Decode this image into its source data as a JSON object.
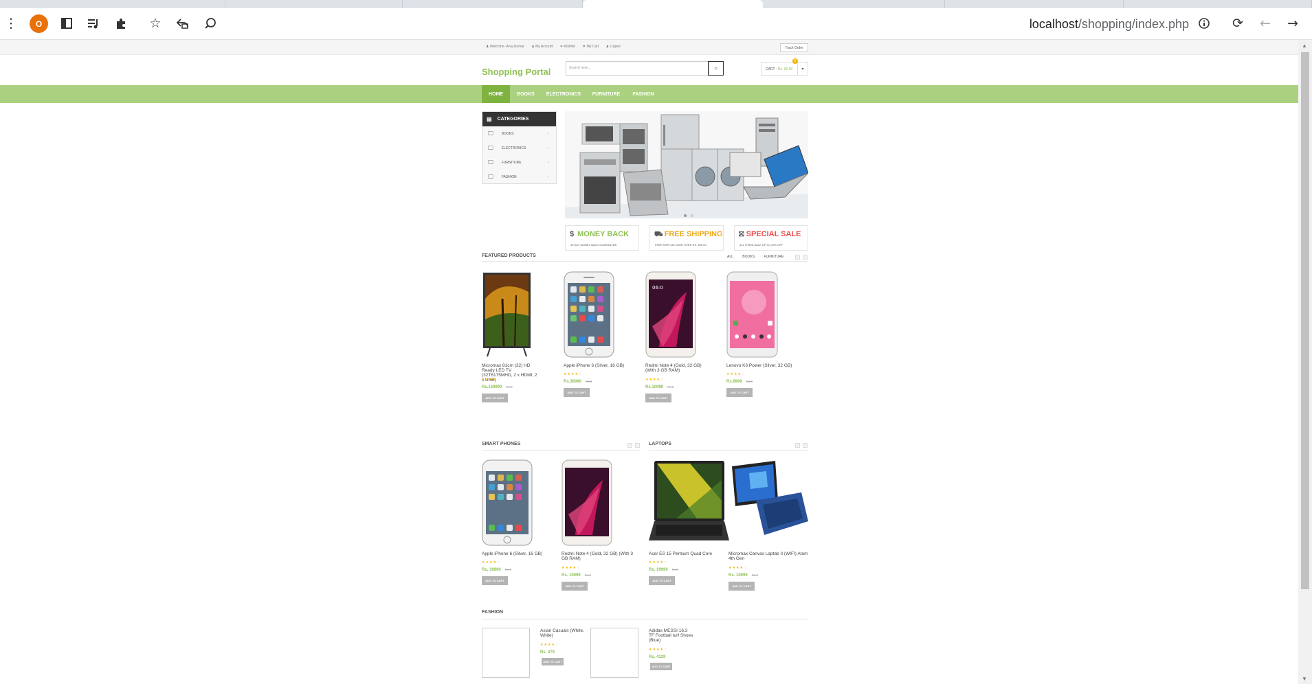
{
  "browser": {
    "profile_initial": "O",
    "url_host": "localhost",
    "url_path": "/shopping/index.php",
    "icons": [
      "menu-icon",
      "profile-avatar",
      "sidebar-icon",
      "reading-list-icon",
      "extensions-icon",
      "bookmark-star-icon",
      "share-icon",
      "lens-search-icon",
      "site-info-icon",
      "reload-icon",
      "back-icon",
      "forward-icon"
    ]
  },
  "header": {
    "top_links": [
      "Welcome -Anuj Kumar",
      "My Account",
      "Wishlist",
      "My Cart",
      "Logout"
    ],
    "track_order": "Track Order",
    "logo": "Shopping Portal",
    "search_placeholder": "Search here...",
    "cart_label": "CART -",
    "cart_price": "Rs. 00.00",
    "cart_count": "0"
  },
  "nav": [
    "HOME",
    "BOOKS",
    "ELECTRONICS",
    "FURNITURE",
    "FASHION"
  ],
  "categories": {
    "title": "CATEGORIES",
    "items": [
      "BOOKS",
      "ELECTRONICS",
      "FURNITURE",
      "FASHION"
    ]
  },
  "info_boxes": [
    {
      "title": "MONEY BACK",
      "subtitle": "30 DAY MONEY BACK GUARANTEE.",
      "color": "#8fc155"
    },
    {
      "title": "FREE SHIPPING",
      "subtitle": "FREE SHIP-ON ODER OVER RS. 600.00",
      "color": "#f0a818"
    },
    {
      "title": "SPECIAL SALE",
      "subtitle": "ALL ITEMS-SALE UP TO 20% OFF",
      "color": "#e84c4c"
    }
  ],
  "featured": {
    "title": "FEATURED PRODUCTS",
    "filters": [
      "ALL",
      "BOOKS",
      "FURNITURE"
    ],
    "products": [
      {
        "name": "Micromax 81cm (32) HD Ready LED TV (32T6175MHD, 2 x HDMI, 2 x USB)",
        "price": "Rs.139990",
        "old": "Rs.0",
        "rating": 4
      },
      {
        "name": "Apple iPhone 6 (Silver, 16 GB)",
        "price": "Rs.36990",
        "old": "Rs.0",
        "rating": 4
      },
      {
        "name": "Redmi Note 4 (Gold, 32 GB) (With 3 GB RAM)",
        "price": "Rs.10999",
        "old": "Rs.0",
        "rating": 4
      },
      {
        "name": "Lenovo K6 Power (Silver, 32 GB)",
        "price": "Rs.9999",
        "old": "Rs.0",
        "rating": 4
      }
    ]
  },
  "smartphones": {
    "title": "SMART PHONES",
    "products": [
      {
        "name": "Apple iPhone 6 (Silver, 16 GB)",
        "price": "Rs. 36990",
        "old": "Rs.0",
        "rating": 4
      },
      {
        "name": "Redmi Note 4 (Gold, 32 GB) (With 3 GB RAM)",
        "price": "Rs. 10999",
        "old": "Rs.0",
        "rating": 4
      }
    ]
  },
  "laptops": {
    "title": "LAPTOPS",
    "products": [
      {
        "name": "Acer ES 15 Pentium Quad Core",
        "price": "Rs. 19990",
        "old": "Rs.0",
        "rating": 4
      },
      {
        "name": "Micromax Canvas Laptab II (WIFI) Atom 4th Gen",
        "price": "Rs. 10999",
        "old": "Rs.0",
        "rating": 4
      }
    ]
  },
  "fashion": {
    "title": "FASHION",
    "products": [
      {
        "name": "Asian Casuals (White, White)",
        "price": "Rs. 379",
        "rating": 4
      },
      {
        "name": "Adidas MESSI 16.3 TF Football turf Shoes (Blue)",
        "price": "Rs. 4129",
        "rating": 4
      }
    ]
  },
  "add_to_cart": "ADD TO CART"
}
